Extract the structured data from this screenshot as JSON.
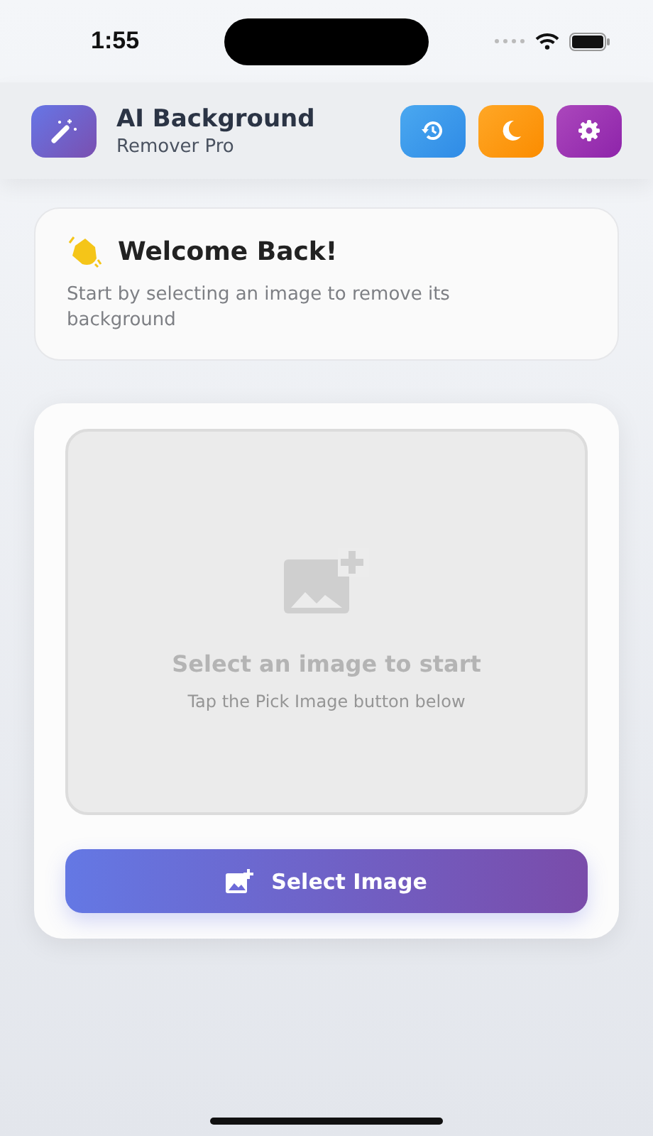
{
  "status_bar": {
    "time": "1:55"
  },
  "header": {
    "title": "AI Background",
    "subtitle": "Remover Pro",
    "actions": [
      {
        "kind": "history"
      },
      {
        "kind": "theme"
      },
      {
        "kind": "settings"
      }
    ]
  },
  "welcome": {
    "title": "Welcome Back!",
    "text": "Start by selecting an image to remove its background"
  },
  "dropzone": {
    "title": "Select an image to start",
    "hint": "Tap the Pick Image button below"
  },
  "select_button": {
    "label": "Select Image"
  }
}
